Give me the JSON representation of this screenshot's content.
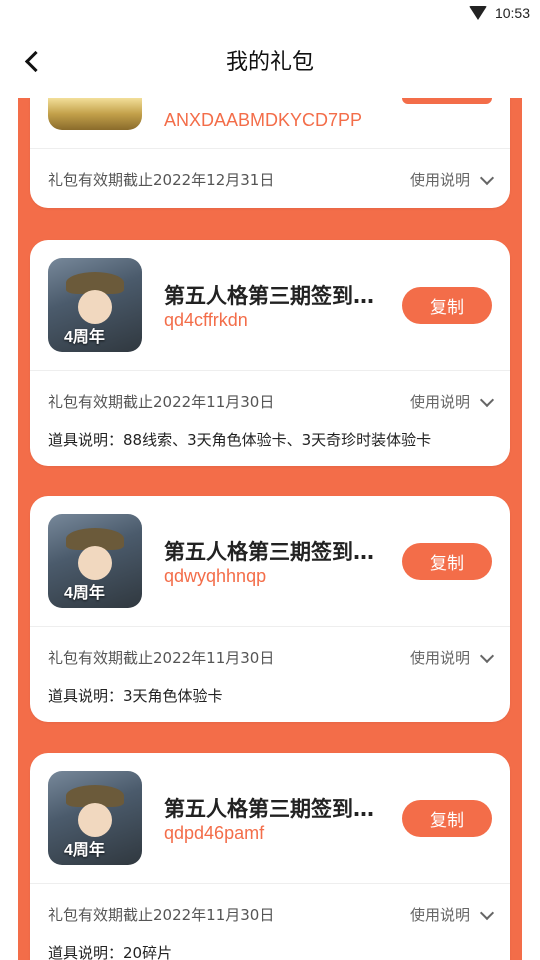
{
  "status_bar": {
    "time": "10:53"
  },
  "header": {
    "title": "我的礼包"
  },
  "guide_label": "使用说明",
  "copy_label": "复制",
  "cards": [
    {
      "code": "ANXDAABMDKYCD7PP",
      "expiry": "礼包有效期截止2022年12月31日"
    },
    {
      "name": "第五人格第三期签到礼包",
      "code": "qd4cffrkdn",
      "expiry": "礼包有效期截止2022年11月30日",
      "desc": "道具说明：88线索、3天角色体验卡、3天奇珍时装体验卡",
      "avatar_badge": "4周年"
    },
    {
      "name": "第五人格第三期签到礼包",
      "code": "qdwyqhhnqp",
      "expiry": "礼包有效期截止2022年11月30日",
      "desc": "道具说明：3天角色体验卡",
      "avatar_badge": "4周年"
    },
    {
      "name": "第五人格第三期签到礼包",
      "code": "qdpd46pamf",
      "expiry": "礼包有效期截止2022年11月30日",
      "desc": "道具说明：20碎片",
      "avatar_badge": "4周年"
    }
  ],
  "colors": {
    "accent": "#f36d49",
    "background": "#ffffff"
  }
}
